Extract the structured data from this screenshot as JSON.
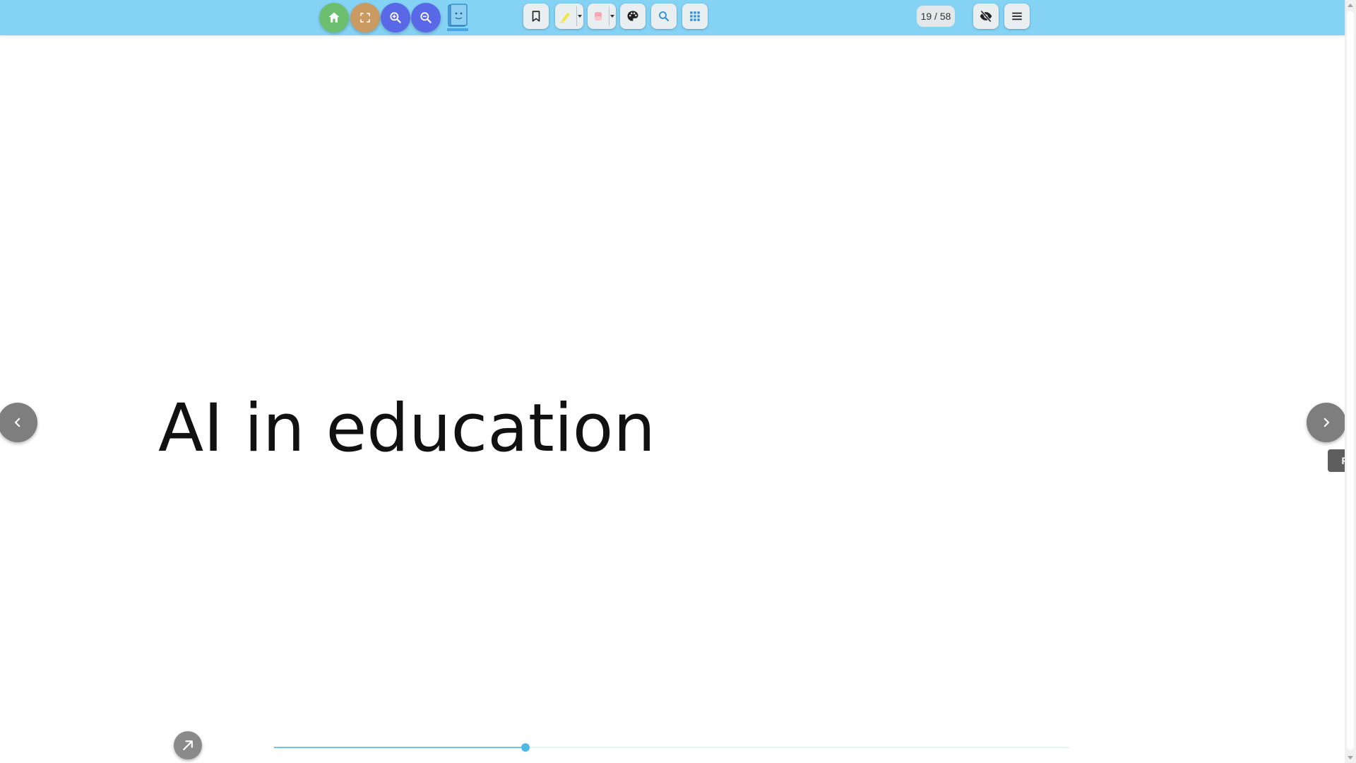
{
  "toolbar": {
    "left_buttons": [
      {
        "name": "home",
        "icon": "home-icon",
        "color": "#6cbf6e"
      },
      {
        "name": "fullscreen",
        "icon": "fullscreen-icon",
        "color": "#c99a62"
      },
      {
        "name": "zoom-in",
        "icon": "zoom-in-icon",
        "color": "#5968e6"
      },
      {
        "name": "zoom-out",
        "icon": "zoom-out-icon",
        "color": "#5968e6"
      }
    ],
    "logo_icon": "book-logo-icon",
    "tool_buttons": [
      {
        "name": "bookmark",
        "icon": "bookmark-icon"
      },
      {
        "name": "highlighter",
        "icon": "highlighter-icon",
        "color": "#f2e63a"
      },
      {
        "name": "eraser",
        "icon": "eraser-icon",
        "color": "#f4a7b3"
      },
      {
        "name": "palette",
        "icon": "palette-icon"
      },
      {
        "name": "search",
        "icon": "search-icon",
        "color": "#2f8fdc"
      },
      {
        "name": "grid",
        "icon": "grid-icon",
        "color": "#2f8fdc"
      }
    ],
    "page_counter": "19 / 58",
    "right_buttons": [
      {
        "name": "hide-toolbar",
        "icon": "eye-off-icon"
      },
      {
        "name": "menu",
        "icon": "hamburger-menu-icon"
      }
    ],
    "background_color": "#84d3f5"
  },
  "slide": {
    "title": "AI in education"
  },
  "navigation": {
    "prev_icon": "chevron-left-icon",
    "next_icon": "chevron-right-icon",
    "side_tab_label": "F"
  },
  "bottom": {
    "share_icon": "arrow-up-right-icon",
    "current_page": 19,
    "total_pages": 58,
    "slider_color": "#4fb8e4"
  }
}
